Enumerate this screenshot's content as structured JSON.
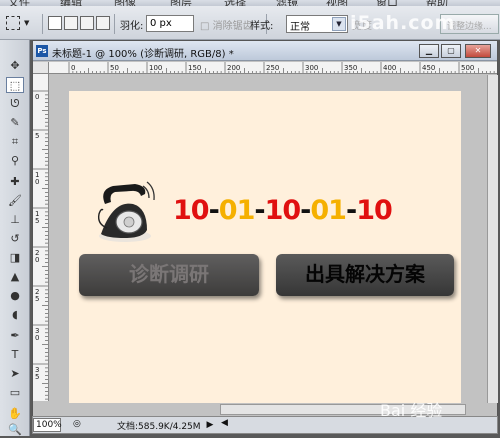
{
  "menubar": {
    "items": [
      "文件",
      "编辑",
      "图像",
      "图层",
      "选择",
      "滤镜",
      "分析",
      "3D",
      "视图",
      "窗口",
      "帮助"
    ]
  },
  "options": {
    "feather_label": "羽化:",
    "feather_value": "0 px",
    "antialias_label": "消除锯齿",
    "style_label": "样式:",
    "style_value": "正常",
    "width_label": "宽度",
    "refine_label": "调整边缘..."
  },
  "document": {
    "title": "未标题-1 @ 100% (诊断调研, RGB/8) *",
    "ruler_h_ticks": [
      "0",
      "50",
      "100",
      "150",
      "200",
      "250",
      "300",
      "350",
      "400",
      "450",
      "500"
    ],
    "ruler_v_ticks": [
      "0",
      "5",
      "1 0",
      "1 5",
      "2 0",
      "2 5",
      "3 0",
      "3 5",
      "4 0"
    ]
  },
  "canvas": {
    "hotline": {
      "parts": [
        "10",
        "-",
        "01",
        "-",
        "10",
        "-",
        "01",
        "-",
        "10"
      ]
    },
    "button_diagnose": "诊断调研",
    "button_solution": "出具解决方案"
  },
  "status": {
    "zoom": "100%",
    "doc_info": "文档:585.9K/4.25M"
  },
  "watermark": {
    "top": "i5ah.com",
    "bottom": "Bai 经验"
  },
  "colors": {
    "canvas_bg": "#fff0dc",
    "hotline_red": "#e01010",
    "hotline_yellow": "#f5b000",
    "button_dark": "#4a4948"
  }
}
